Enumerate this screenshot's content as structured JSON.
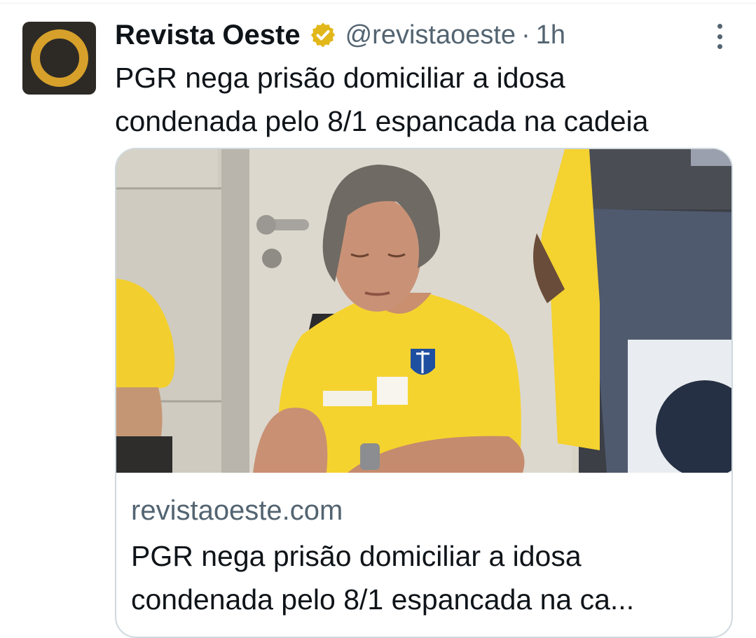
{
  "tweet": {
    "author_name": "Revista Oeste",
    "handle": "@revistaoeste",
    "separator": "·",
    "time": "1h",
    "text_line1": "PGR nega prisão domiciliar a idosa",
    "text_line2": "condenada pelo 8/1 espancada na cadeia"
  },
  "card": {
    "domain": "revistaoeste.com",
    "title_line1": "PGR nega prisão domiciliar a idosa",
    "title_line2": "condenada pelo 8/1 espancada na ca...",
    "photo_subject": "woman-in-yellow-brazil-jersey"
  },
  "colors": {
    "text_primary": "#0f1419",
    "text_secondary": "#536471",
    "verified_gold": "#e2b719",
    "avatar_bg": "#2d2a26",
    "avatar_ring": "#d6a02a",
    "card_border": "#cfd9de"
  },
  "icons": {
    "verified": "verified-badge-icon",
    "more": "more-options-icon"
  }
}
